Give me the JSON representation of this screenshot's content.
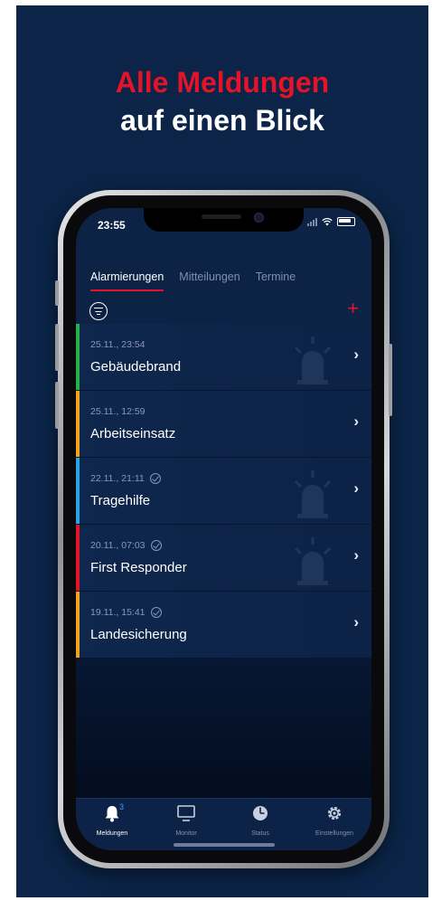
{
  "headline": {
    "line1": "Alle Meldungen",
    "line2": "auf einen Blick"
  },
  "status_bar": {
    "time": "23:55"
  },
  "tabs": [
    {
      "label": "Alarmierungen",
      "active": true
    },
    {
      "label": "Mitteilungen",
      "active": false
    },
    {
      "label": "Termine",
      "active": false
    }
  ],
  "toolbar": {
    "filter_icon": "filter-icon",
    "add_label": "+"
  },
  "alerts": [
    {
      "datetime": "25.11., 23:54",
      "title": "Gebäudebrand",
      "color": "#24b14a",
      "confirmed": false,
      "siren": true
    },
    {
      "datetime": "25.11., 12:59",
      "title": "Arbeitseinsatz",
      "color": "#f0a21a",
      "confirmed": false,
      "siren": false
    },
    {
      "datetime": "22.11., 21:11",
      "title": "Tragehilfe",
      "color": "#2aa3e6",
      "confirmed": true,
      "siren": true
    },
    {
      "datetime": "20.11., 07:03",
      "title": "First Responder",
      "color": "#e3142a",
      "confirmed": true,
      "siren": true
    },
    {
      "datetime": "19.11., 15:41",
      "title": "Landesicherung",
      "color": "#f0a21a",
      "confirmed": true,
      "siren": false
    }
  ],
  "tabbar": {
    "items": [
      {
        "label": "Meldungen",
        "icon": "bell-icon",
        "active": true,
        "badge": "3"
      },
      {
        "label": "Monitor",
        "icon": "monitor-icon",
        "active": false
      },
      {
        "label": "Status",
        "icon": "pie-icon",
        "active": false
      },
      {
        "label": "Einstellungen",
        "icon": "gear-icon",
        "active": false
      }
    ]
  },
  "colors": {
    "brand_red": "#e3142a",
    "background": "#0b2447"
  }
}
